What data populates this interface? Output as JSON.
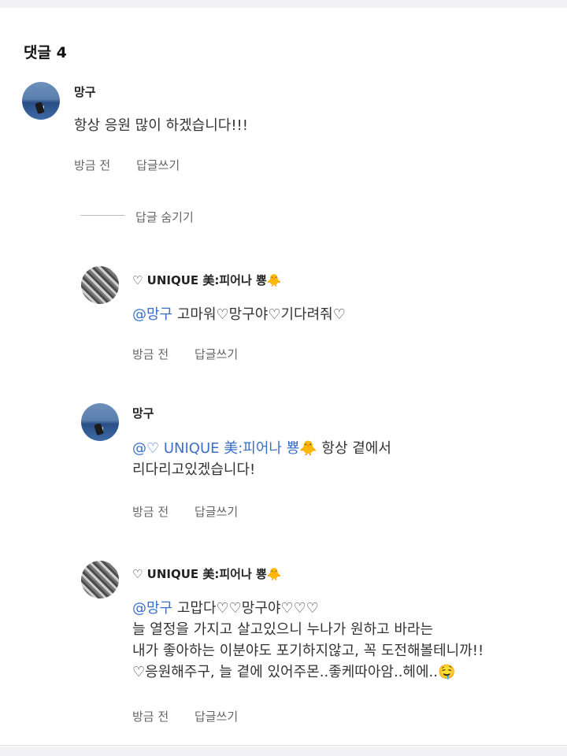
{
  "header": {
    "title": "댓글 4"
  },
  "comments": [
    {
      "author": "망구",
      "text": "항상 응원 많이 하겠습니다!!!",
      "time": "방금 전",
      "reply_label": "답글쓰기"
    }
  ],
  "thread": {
    "hide_replies_label": "답글 숨기기"
  },
  "replies": [
    {
      "author": "♡ UNIQUE 美:피어나 뿅🐥",
      "mention": "@망구",
      "lines": [
        " 고마워♡망구야♡기다려줘♡"
      ],
      "time": "방금 전",
      "reply_label": "답글쓰기"
    },
    {
      "author": "망구",
      "mention": "@♡ UNIQUE 美:피어나 뿅🐥",
      "lines": [
        " 항상 곁에서",
        "리다리고있겠습니다!"
      ],
      "time": "방금 전",
      "reply_label": "답글쓰기"
    },
    {
      "author": "♡ UNIQUE 美:피어나 뿅🐥",
      "mention": "@망구",
      "lines": [
        " 고맙다♡♡망구야♡♡♡",
        "늘 열정을 가지고 살고있으니 누나가 원하고 바라는",
        "내가 좋아하는 이분야도 포기하지않고, 꼭 도전해볼테니까!!",
        "♡응원해주구, 늘 곁에 있어주몬..좋케따아암..헤에..🤤"
      ],
      "time": "방금 전",
      "reply_label": "답글쓰기"
    }
  ]
}
